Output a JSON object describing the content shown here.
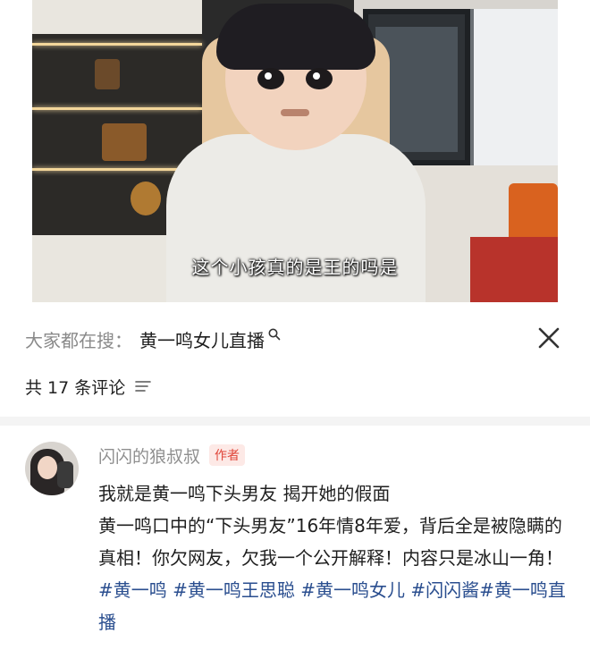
{
  "video": {
    "subtitle": "这个小孩真的是王的吗是"
  },
  "search_bar": {
    "prefix": "大家都在搜：",
    "term": "黄一鸣女儿直播",
    "icon": "search-icon"
  },
  "close_icon": "close-icon",
  "comments_header": {
    "count_text": "共 17 条评论",
    "sort_icon": "sort-icon"
  },
  "comment": {
    "author": "闪闪的狼叔叔",
    "badge": "作者",
    "text_parts": [
      "我就是黄一鸣下头男友 揭开她的假面",
      "黄一鸣口中的“下头男友”16年情8年爱，背后全是被隐瞒的真相！你欠网友，欠我一个公开解释！内容只是冰山一角！"
    ],
    "hashtags": [
      "#黄一鸣",
      "#黄一鸣王思聪",
      "#黄一鸣女儿",
      "#闪闪酱",
      "#黄一鸣直播"
    ]
  },
  "colors": {
    "hashtag": "#2a4e8f",
    "badge_text": "#e0463a",
    "badge_bg": "#fde9e6",
    "muted": "#8a8a8a"
  }
}
